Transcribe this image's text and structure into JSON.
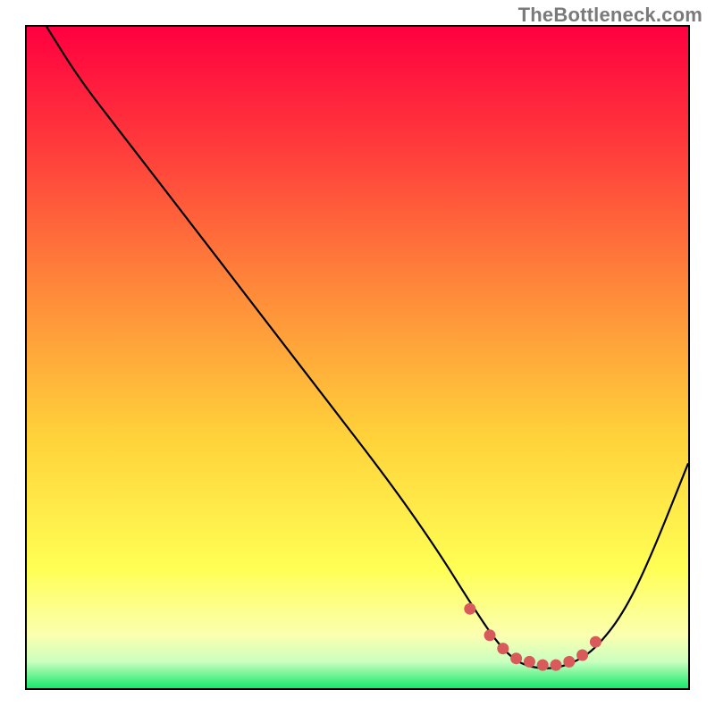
{
  "watermark": "TheBottleneck.com",
  "colors": {
    "gradient_stops": [
      {
        "offset": "0%",
        "color": "#ff0040"
      },
      {
        "offset": "18%",
        "color": "#ff3b3b"
      },
      {
        "offset": "40%",
        "color": "#ff8a3a"
      },
      {
        "offset": "62%",
        "color": "#ffd23a"
      },
      {
        "offset": "82%",
        "color": "#ffff55"
      },
      {
        "offset": "92%",
        "color": "#fbffb0"
      },
      {
        "offset": "96%",
        "color": "#caffc0"
      },
      {
        "offset": "100%",
        "color": "#17e86b"
      }
    ],
    "curve_stroke": "#000000",
    "dot_fill": "#d85a5a"
  },
  "chart_data": {
    "type": "line",
    "title": "",
    "xlabel": "",
    "ylabel": "",
    "xlim": [
      0,
      100
    ],
    "ylim": [
      0,
      100
    ],
    "series": [
      {
        "name": "bottleneck-curve",
        "x": [
          3,
          8,
          15,
          25,
          35,
          45,
          55,
          62,
          67,
          71,
          74,
          77,
          80,
          83,
          86,
          90,
          94,
          100
        ],
        "y": [
          100,
          92,
          83,
          70,
          57,
          44,
          31,
          21,
          13,
          7,
          4,
          3,
          3,
          4,
          6,
          11,
          19,
          34
        ]
      }
    ],
    "optimal_zone_dots": {
      "x": [
        67,
        70,
        72,
        74,
        76,
        78,
        80,
        82,
        84,
        86
      ],
      "y": [
        12,
        8,
        6,
        4.5,
        4,
        3.5,
        3.5,
        4,
        5,
        7
      ]
    }
  }
}
